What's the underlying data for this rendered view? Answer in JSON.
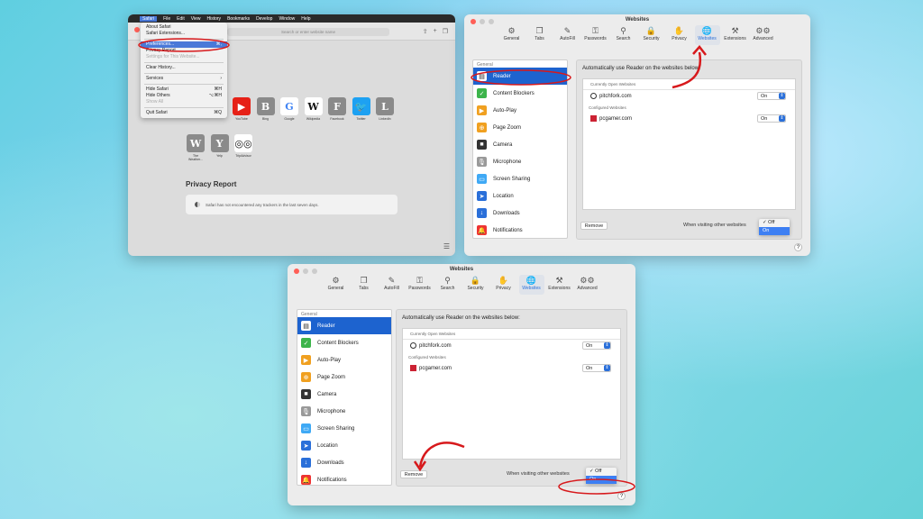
{
  "safari": {
    "menubar": [
      "Safari",
      "File",
      "Edit",
      "View",
      "History",
      "Bookmarks",
      "Develop",
      "Window",
      "Help"
    ],
    "address_placeholder": "Search or enter website name",
    "menu": [
      {
        "label": "About Safari",
        "shortcut": "",
        "state": ""
      },
      {
        "label": "Safari Extensions...",
        "shortcut": "",
        "state": ""
      },
      {
        "sep": true
      },
      {
        "label": "Preferences...",
        "shortcut": "⌘,",
        "state": "hl"
      },
      {
        "label": "Privacy Report...",
        "shortcut": "",
        "state": ""
      },
      {
        "label": "Settings for This Website...",
        "shortcut": "",
        "state": "dis"
      },
      {
        "sep": true
      },
      {
        "label": "Clear History...",
        "shortcut": "",
        "state": ""
      },
      {
        "sep": true
      },
      {
        "label": "Services",
        "shortcut": "›",
        "state": ""
      },
      {
        "sep": true
      },
      {
        "label": "Hide Safari",
        "shortcut": "⌘H",
        "state": ""
      },
      {
        "label": "Hide Others",
        "shortcut": "⌥⌘H",
        "state": ""
      },
      {
        "label": "Show All",
        "shortcut": "",
        "state": "dis"
      },
      {
        "sep": true
      },
      {
        "label": "Quit Safari",
        "shortcut": "⌘Q",
        "state": ""
      }
    ],
    "favorites": [
      {
        "glyph": "▶",
        "label": "YouTube",
        "color": "#e62117",
        "fg": "#fff"
      },
      {
        "glyph": "B",
        "label": "Bing",
        "color": "#8a8a8a",
        "fg": "#fff"
      },
      {
        "glyph": "G",
        "label": "Google",
        "color": "#fff",
        "fg": "#4285f4"
      },
      {
        "glyph": "W",
        "label": "Wikipedia",
        "color": "#fff",
        "fg": "#111"
      },
      {
        "glyph": "F",
        "label": "Facebook",
        "color": "#8a8a8a",
        "fg": "#fff"
      },
      {
        "glyph": "🐦",
        "label": "Twitter",
        "color": "#1da1f2",
        "fg": "#fff"
      },
      {
        "glyph": "L",
        "label": "LinkedIn",
        "color": "#8a8a8a",
        "fg": "#fff"
      },
      {
        "glyph": "W",
        "label": "The Weather...",
        "color": "#8a8a8a",
        "fg": "#fff"
      },
      {
        "glyph": "Y",
        "label": "Yelp",
        "color": "#8a8a8a",
        "fg": "#fff"
      },
      {
        "glyph": "◎◎",
        "label": "TripAdvisor",
        "color": "#fff",
        "fg": "#111"
      }
    ],
    "privacy_title": "Privacy Report",
    "privacy_text": "Safari has not encountered any trackers in the last seven days."
  },
  "prefs": {
    "title": "Websites",
    "tabs": [
      {
        "label": "General",
        "icon": "⚙"
      },
      {
        "label": "Tabs",
        "icon": "❐"
      },
      {
        "label": "AutoFill",
        "icon": "✎"
      },
      {
        "label": "Passwords",
        "icon": "⚿"
      },
      {
        "label": "Search",
        "icon": "⚲"
      },
      {
        "label": "Security",
        "icon": "🔒"
      },
      {
        "label": "Privacy",
        "icon": "✋"
      },
      {
        "label": "Websites",
        "icon": "🌐",
        "active": true
      },
      {
        "label": "Extensions",
        "icon": "⚒"
      },
      {
        "label": "Advanced",
        "icon": "⚙⚙"
      }
    ],
    "sidebar_header": "General",
    "sidebar": [
      {
        "label": "Reader",
        "icon": "▤",
        "color": "#222",
        "sel": true
      },
      {
        "label": "Content Blockers",
        "icon": "✓",
        "color": "#3cb44b"
      },
      {
        "label": "Auto-Play",
        "icon": "▶",
        "color": "#f0a020"
      },
      {
        "label": "Page Zoom",
        "icon": "⊕",
        "color": "#f0a020"
      },
      {
        "label": "Camera",
        "icon": "■",
        "color": "#333"
      },
      {
        "label": "Microphone",
        "icon": "🎙",
        "color": "#999"
      },
      {
        "label": "Screen Sharing",
        "icon": "▭",
        "color": "#3fa9f5"
      },
      {
        "label": "Location",
        "icon": "➤",
        "color": "#2a6fd9"
      },
      {
        "label": "Downloads",
        "icon": "↓",
        "color": "#2a6fd9"
      },
      {
        "label": "Notifications",
        "icon": "🔔",
        "color": "#e33"
      }
    ],
    "main_header": "Automatically use Reader on the websites below:",
    "section_open": "Currently Open Websites",
    "section_configured": "Configured Websites",
    "sites": [
      {
        "name": "pitchfork.com",
        "value": "On"
      },
      {
        "name": "pcgamer.com",
        "value": "On"
      }
    ],
    "remove": "Remove",
    "visiting": "When visiting other websites",
    "options": [
      "✓ Off",
      "On"
    ],
    "help": "?"
  }
}
